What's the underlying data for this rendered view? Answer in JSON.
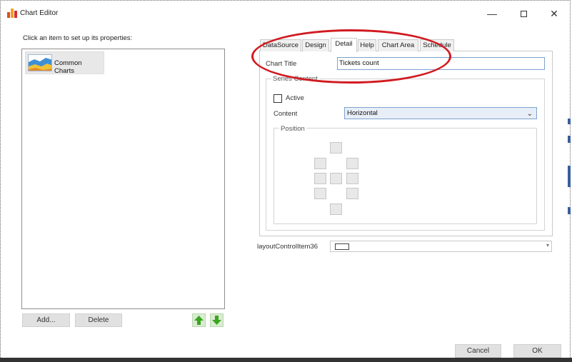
{
  "window": {
    "title": "Chart Editor",
    "min_glyph": "—",
    "close_glyph": "✕"
  },
  "left_panel": {
    "instruction": "Click an item to set up  its properties:",
    "items": [
      {
        "label": "Common Charts"
      }
    ],
    "add_label": "Add...",
    "delete_label": "Delete"
  },
  "tabs": [
    "DataSource",
    "Design",
    "Detail",
    "Help",
    "Chart Area",
    "Schedule"
  ],
  "detail": {
    "chart_title_label": "Chart Title",
    "chart_title_value": "Tickets count",
    "group_label": "Series Content",
    "active_label": "Active",
    "active_checked": false,
    "content_label": "Content",
    "content_value": "Horizontal",
    "position_label": "Position"
  },
  "layout_item": {
    "label": "layoutControlItem36"
  },
  "footer": {
    "cancel_label": "Cancel",
    "ok_label": "OK"
  },
  "colors": {
    "highlight": "#d11a20",
    "arrow_green": "#3aa51f",
    "input_border": "#7da2ce"
  },
  "icons": {
    "move_up": "arrow-up-icon",
    "move_down": "arrow-down-icon",
    "chart": "area-chart-icon",
    "app": "chart-editor-app-icon"
  }
}
